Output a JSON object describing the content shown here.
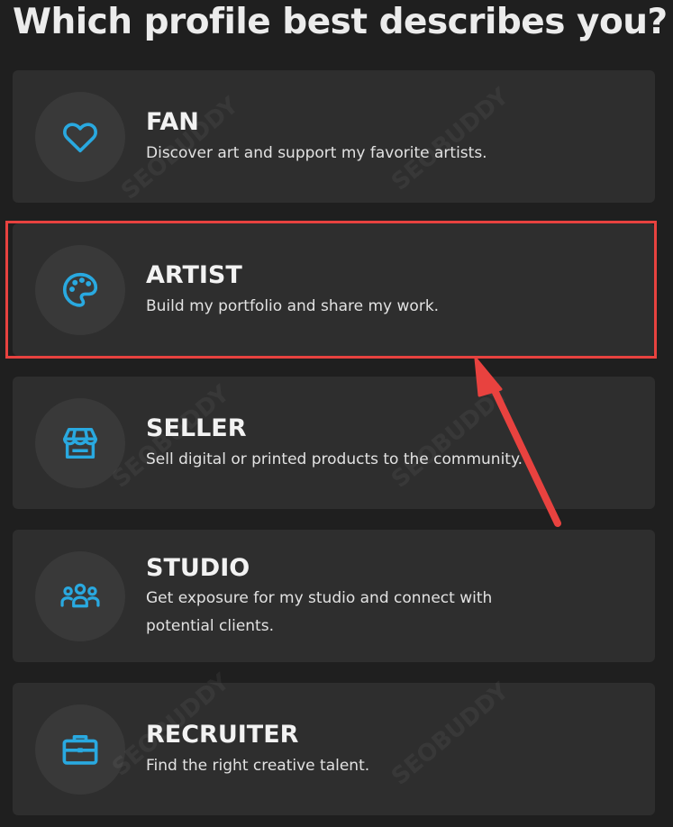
{
  "page": {
    "title": "Which profile best describes you?"
  },
  "profiles": [
    {
      "title": "FAN",
      "description": "Discover art and support my favorite artists.",
      "icon": "heart-icon"
    },
    {
      "title": "ARTIST",
      "description": "Build my portfolio and share my work.",
      "icon": "palette-icon"
    },
    {
      "title": "SELLER",
      "description": "Sell digital or printed products to the community.",
      "icon": "store-icon"
    },
    {
      "title": "STUDIO",
      "description": "Get exposure for my studio and connect with potential clients.",
      "icon": "team-icon"
    },
    {
      "title": "RECRUITER",
      "description": "Find the right creative talent.",
      "icon": "briefcase-icon"
    }
  ],
  "annotation": {
    "highlight_color": "#e8423f",
    "highlighted_profile": "ARTIST"
  },
  "watermark": {
    "text": "SEOBUDDY"
  },
  "colors": {
    "accent": "#29a9e0",
    "card_bg": "#2e2e2e",
    "page_bg": "#1f1f1f"
  }
}
